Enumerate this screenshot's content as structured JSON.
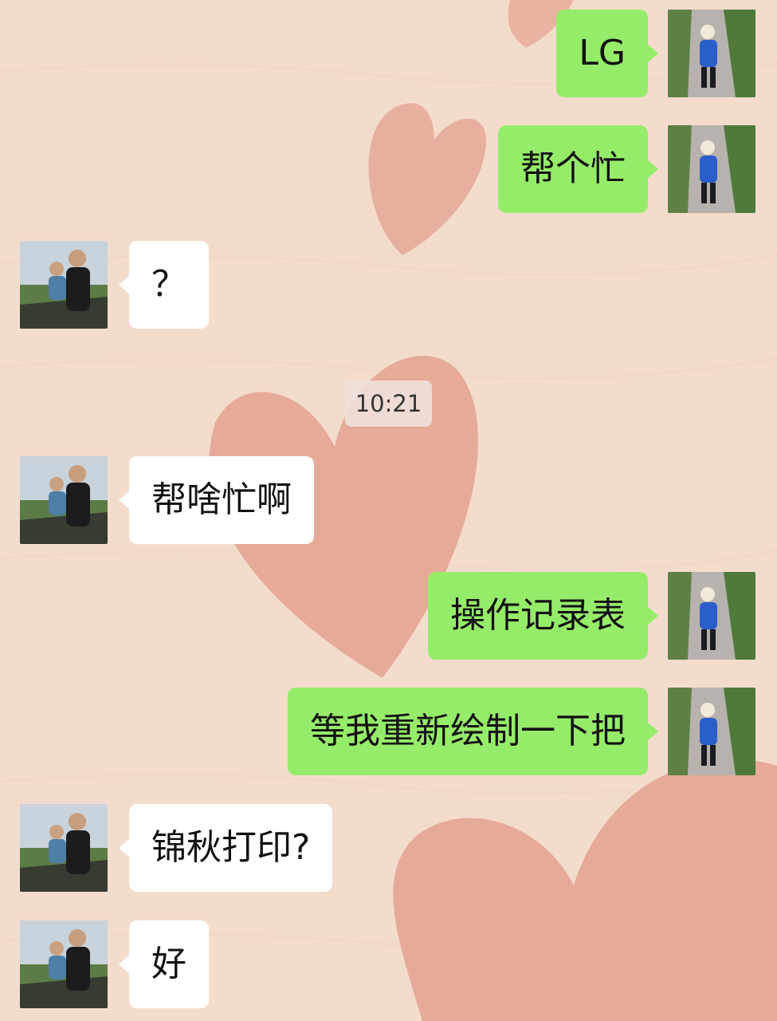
{
  "colors": {
    "background": "#f4dccd",
    "heart": "#e2a08c",
    "outgoing_bubble": "#95ec69",
    "incoming_bubble": "#ffffff",
    "timestamp_chip": "#eee1da"
  },
  "avatars": {
    "self": "child-walking-photo-avatar",
    "contact": "adult-holding-child-photo-avatar"
  },
  "messages": [
    {
      "direction": "out",
      "text": "LG"
    },
    {
      "direction": "out",
      "text": "帮个忙"
    },
    {
      "direction": "in",
      "text": "？"
    },
    {
      "direction": "in",
      "text": "帮啥忙啊"
    },
    {
      "direction": "out",
      "text": "操作记录表"
    },
    {
      "direction": "out",
      "text": "等我重新绘制一下把"
    },
    {
      "direction": "in",
      "text": "锦秋打印?"
    },
    {
      "direction": "in",
      "text": "好"
    }
  ],
  "timestamp": "10:21"
}
